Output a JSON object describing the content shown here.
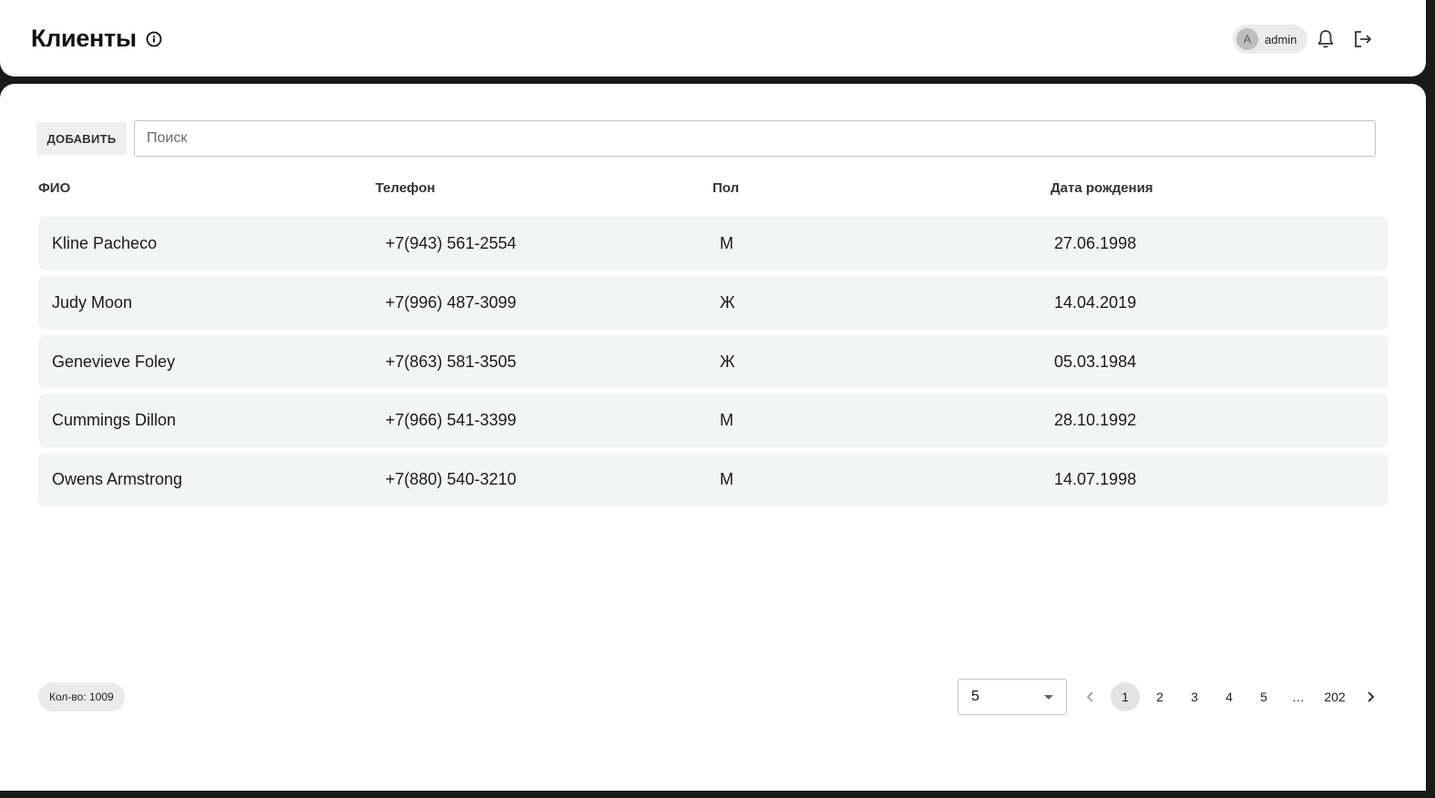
{
  "header": {
    "title": "Клиенты",
    "user": {
      "avatar_letter": "A",
      "name": "admin"
    }
  },
  "toolbar": {
    "add_label": "ДОБАВИТЬ",
    "search_placeholder": "Поиск",
    "search_value": ""
  },
  "table": {
    "columns": [
      "ФИО",
      "Телефон",
      "Пол",
      "Дата рождения"
    ],
    "rows": [
      {
        "name": "Kline Pacheco",
        "phone": "+7(943) 561-2554",
        "sex": "М",
        "dob": "27.06.1998"
      },
      {
        "name": "Judy Moon",
        "phone": "+7(996) 487-3099",
        "sex": "Ж",
        "dob": "14.04.2019"
      },
      {
        "name": "Genevieve Foley",
        "phone": "+7(863) 581-3505",
        "sex": "Ж",
        "dob": "05.03.1984"
      },
      {
        "name": "Cummings Dillon",
        "phone": "+7(966) 541-3399",
        "sex": "М",
        "dob": "28.10.1992"
      },
      {
        "name": "Owens Armstrong",
        "phone": "+7(880) 540-3210",
        "sex": "М",
        "dob": "14.07.1998"
      }
    ]
  },
  "footer": {
    "count_label": "Кол-во: 1009",
    "page_size": "5",
    "pages": [
      "1",
      "2",
      "3",
      "4",
      "5",
      "…",
      "202"
    ],
    "current_page": "1"
  },
  "colors": {
    "row_bg": "#f3f4f4",
    "frame_bg": "#1a1a1a",
    "active_page_bg": "#e3e3e3"
  }
}
